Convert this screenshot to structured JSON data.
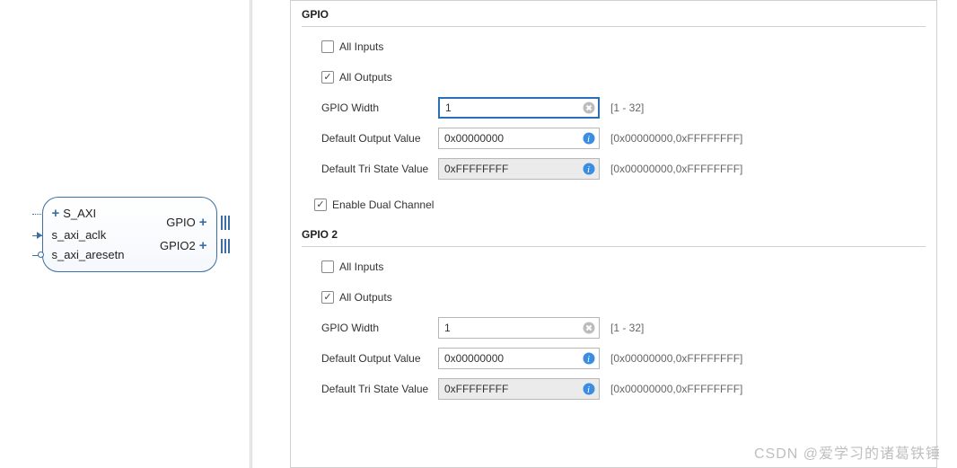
{
  "ip_block": {
    "ports_left": [
      {
        "name": "S_AXI",
        "plus": true
      },
      {
        "name": "s_axi_aclk"
      },
      {
        "name": "s_axi_aresetn"
      }
    ],
    "ports_right": [
      {
        "name": "GPIO",
        "plus": true
      },
      {
        "name": "GPIO2",
        "plus": true
      }
    ]
  },
  "gpio": {
    "title": "GPIO",
    "all_inputs": {
      "label": "All Inputs",
      "checked": false
    },
    "all_outputs": {
      "label": "All Outputs",
      "checked": true
    },
    "width": {
      "label": "GPIO Width",
      "value": "1",
      "hint": "[1 - 32]"
    },
    "default_output": {
      "label": "Default Output Value",
      "value": "0x00000000",
      "hint": "[0x00000000,0xFFFFFFFF]"
    },
    "default_tristate": {
      "label": "Default Tri State Value",
      "value": "0xFFFFFFFF",
      "hint": "[0x00000000,0xFFFFFFFF]"
    }
  },
  "enable_dual": {
    "label": "Enable Dual Channel",
    "checked": true
  },
  "gpio2": {
    "title": "GPIO 2",
    "all_inputs": {
      "label": "All Inputs",
      "checked": false
    },
    "all_outputs": {
      "label": "All Outputs",
      "checked": true
    },
    "width": {
      "label": "GPIO Width",
      "value": "1",
      "hint": "[1 - 32]"
    },
    "default_output": {
      "label": "Default Output Value",
      "value": "0x00000000",
      "hint": "[0x00000000,0xFFFFFFFF]"
    },
    "default_tristate": {
      "label": "Default Tri State Value",
      "value": "0xFFFFFFFF",
      "hint": "[0x00000000,0xFFFFFFFF]"
    }
  },
  "watermark": "CSDN @爱学习的诸葛铁锤"
}
